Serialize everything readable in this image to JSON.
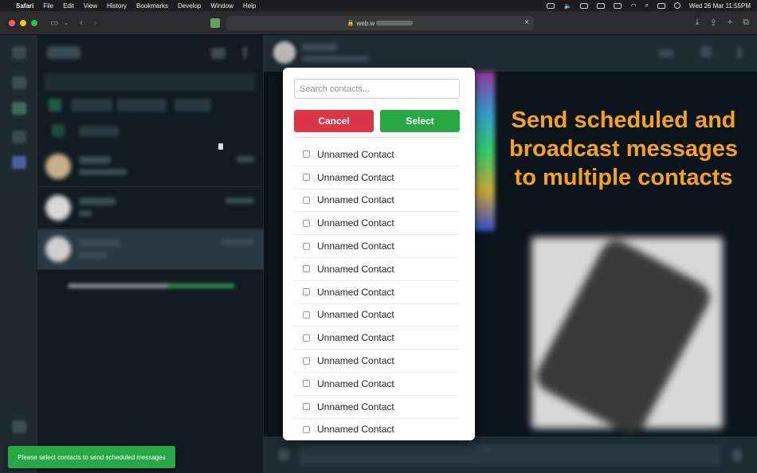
{
  "menubar": {
    "app": "Safari",
    "items": [
      "File",
      "Edit",
      "View",
      "History",
      "Bookmarks",
      "Develop",
      "Window",
      "Help"
    ],
    "clock": "Wed 26 Mar  11:55PM"
  },
  "toolbar": {
    "url": "web.w",
    "icons": [
      "sidebar-icon",
      "chevron-down-icon",
      "back-icon",
      "forward-icon",
      "download-icon",
      "share-icon",
      "new-tab-icon",
      "tab-overview-icon"
    ]
  },
  "modal": {
    "search_placeholder": "Search contacts...",
    "cancel_label": "Cancel",
    "select_label": "Select",
    "contacts": [
      "Unnamed Contact",
      "Unnamed Contact",
      "Unnamed Contact",
      "Unnamed Contact",
      "Unnamed Contact",
      "Unnamed Contact",
      "Unnamed Contact",
      "Unnamed Contact",
      "Unnamed Contact",
      "Unnamed Contact",
      "Unnamed Contact",
      "Unnamed Contact",
      "Unnamed Contact"
    ]
  },
  "promo": {
    "line1": "Send scheduled and",
    "line2": "broadcast messages",
    "line3": "to multiple contacts"
  },
  "toast": {
    "message": "Please select contacts to send scheduled messages"
  },
  "colors": {
    "cancel": "#dc3545",
    "select": "#28a745",
    "promo": "#f5a21e",
    "toast": "#28a745"
  }
}
